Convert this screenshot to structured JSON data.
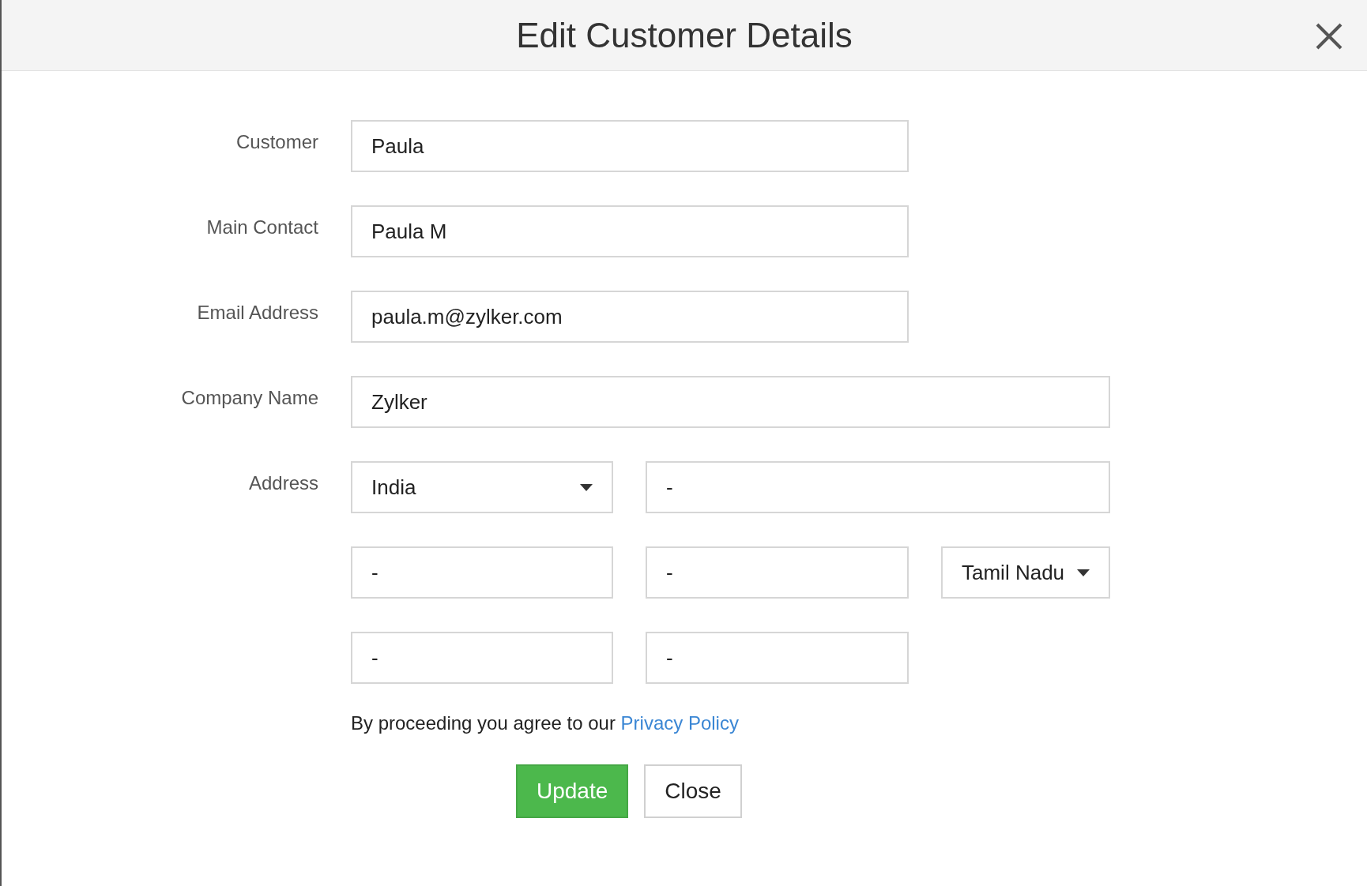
{
  "dialog": {
    "title": "Edit Customer Details"
  },
  "fields": [
    {
      "label": "Customer",
      "value": "Paula",
      "kind": "short"
    },
    {
      "label": "Main Contact",
      "value": "Paula M",
      "kind": "short"
    },
    {
      "label": "Email Address",
      "value": "paula.m@zylker.com",
      "kind": "short"
    },
    {
      "label": "Company Name",
      "value": "Zylker",
      "kind": "wide"
    }
  ],
  "address": {
    "label": "Address",
    "parts": [
      {
        "kind": "select",
        "value": "India"
      },
      {
        "kind": "text",
        "value": "-"
      },
      {
        "kind": "text",
        "value": "-"
      },
      {
        "kind": "text",
        "value": "-"
      },
      {
        "kind": "select",
        "value": "Tamil Nadu"
      },
      {
        "kind": "text",
        "value": "-"
      },
      {
        "kind": "text",
        "value": "-"
      }
    ]
  },
  "consent": {
    "text": "By proceeding you agree to our",
    "link": "Privacy Policy"
  },
  "buttons": [
    {
      "label": "Update",
      "kind": "primary"
    },
    {
      "label": "Close",
      "kind": "secondary"
    }
  ]
}
